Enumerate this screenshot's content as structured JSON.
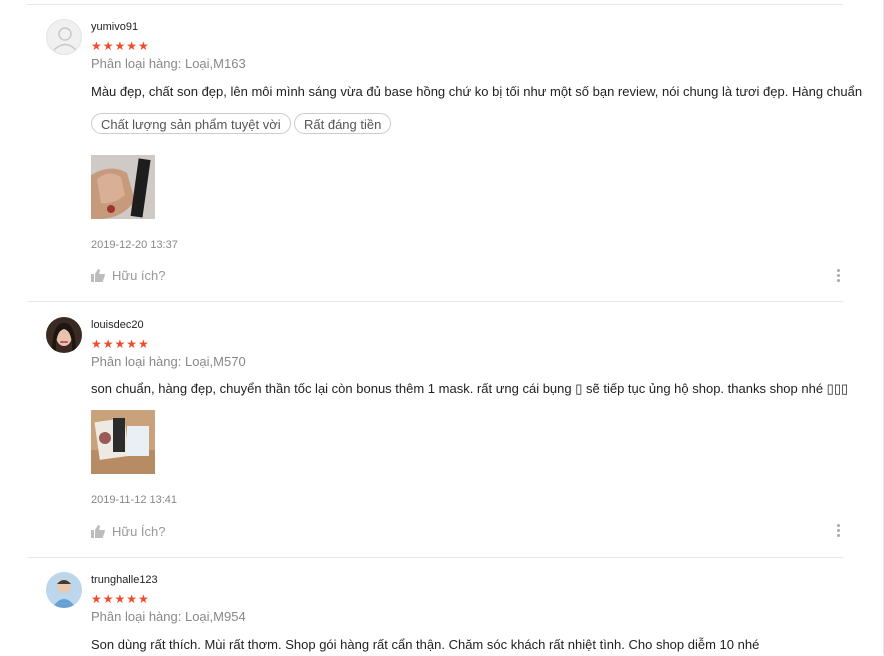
{
  "reviews": [
    {
      "username": "yumivo91",
      "stars": "★★★★★",
      "variation": "Phân loại hàng: Loại,M163",
      "content": "Màu đẹp, chất son đẹp, lên môi mình sáng vừa đủ base hồng chứ ko bị tối như một số bạn review, nói chung là tươi đẹp. Hàng chuẩn",
      "tags": [
        "Chất lượng sản phẩm tuyệt vời",
        "Rất đáng tiền"
      ],
      "date": "2019-12-20 13:37",
      "helpful": "Hữu ích?"
    },
    {
      "username": "louisdec20",
      "stars": "★★★★★",
      "variation": "Phân loại hàng: Loại,M570",
      "content": "son chuẩn, hàng đẹp, chuyển thần tốc lại còn bonus thêm 1 mask. rất ưng cái bụng ▯ sẽ tiếp tục ủng hộ shop. thanks shop nhé ▯▯▯",
      "date": "2019-11-12 13:41",
      "helpful": "Hữu Ích?"
    },
    {
      "username": "trunghalle123",
      "stars": "★★★★★",
      "variation": "Phân loại hàng: Loại,M954",
      "content": "Son dùng rất thích. Mùi rất thơm. Shop gói hàng rất cẩn thận. Chăm sóc khách rất nhiệt tình. Cho shop diễm 10 nhé"
    }
  ]
}
